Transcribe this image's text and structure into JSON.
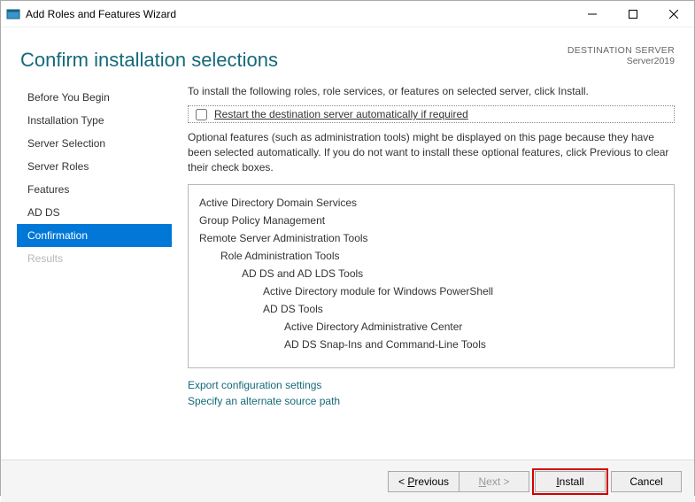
{
  "titlebar": {
    "title": "Add Roles and Features Wizard"
  },
  "header": {
    "heading": "Confirm installation selections",
    "server_label": "DESTINATION SERVER",
    "server_name": "Server2019"
  },
  "sidebar": {
    "items": [
      {
        "label": "Before You Begin",
        "state": "normal"
      },
      {
        "label": "Installation Type",
        "state": "normal"
      },
      {
        "label": "Server Selection",
        "state": "normal"
      },
      {
        "label": "Server Roles",
        "state": "normal"
      },
      {
        "label": "Features",
        "state": "normal"
      },
      {
        "label": "AD DS",
        "state": "normal"
      },
      {
        "label": "Confirmation",
        "state": "active"
      },
      {
        "label": "Results",
        "state": "disabled"
      }
    ]
  },
  "content": {
    "instruction": "To install the following roles, role services, or features on selected server, click Install.",
    "checkbox_label": "Restart the destination server automatically if required",
    "checkbox_checked": false,
    "optional_note": "Optional features (such as administration tools) might be displayed on this page because they have been selected automatically. If you do not want to install these optional features, click Previous to clear their check boxes.",
    "selections": [
      {
        "label": "Active Directory Domain Services",
        "indent": 0
      },
      {
        "label": "Group Policy Management",
        "indent": 0
      },
      {
        "label": "Remote Server Administration Tools",
        "indent": 0
      },
      {
        "label": "Role Administration Tools",
        "indent": 1
      },
      {
        "label": "AD DS and AD LDS Tools",
        "indent": 2
      },
      {
        "label": "Active Directory module for Windows PowerShell",
        "indent": 3
      },
      {
        "label": "AD DS Tools",
        "indent": 3
      },
      {
        "label": "Active Directory Administrative Center",
        "indent": 4
      },
      {
        "label": "AD DS Snap-Ins and Command-Line Tools",
        "indent": 4
      }
    ],
    "links": {
      "export": "Export configuration settings",
      "alt_source": "Specify an alternate source path"
    }
  },
  "footer": {
    "previous": "revious",
    "next": "ext >",
    "install": "nstall",
    "cancel": "Cancel"
  }
}
